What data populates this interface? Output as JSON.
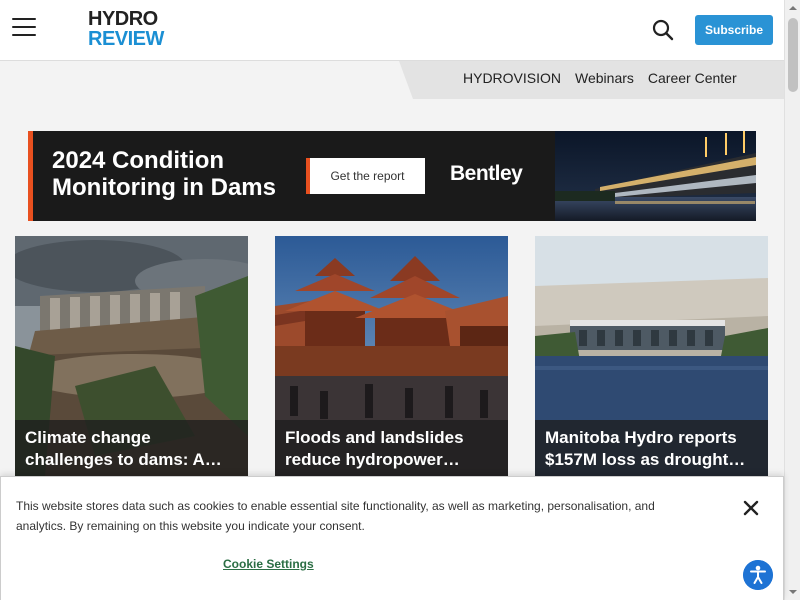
{
  "header": {
    "logo_line1": "HYDRO",
    "logo_line2": "REVIEW",
    "subscribe_label": "Subscribe",
    "icons": {
      "menu": "hamburger-menu-icon",
      "search": "search-icon"
    }
  },
  "subnav": {
    "links": [
      "HYDROVISION",
      "Webinars",
      "Career Center"
    ]
  },
  "ad": {
    "title": "2024 Condition Monitoring in Dams",
    "cta_label": "Get the report",
    "brand": "Bentley"
  },
  "cards": [
    {
      "title": "Climate change challenges to dams: A…"
    },
    {
      "title": "Floods and landslides reduce hydropower…"
    },
    {
      "title": "Manitoba Hydro reports $157M loss as drought…"
    }
  ],
  "cookie": {
    "text": "This website stores data such as cookies to enable essential site functionality, as well as marketing, personalisation, and analytics. By remaining on this website you indicate your consent.",
    "settings_label": "Cookie Settings"
  },
  "colors": {
    "accent_blue": "#2a93d5",
    "ad_accent": "#e8501f",
    "cookie_link": "#2b6e44"
  }
}
